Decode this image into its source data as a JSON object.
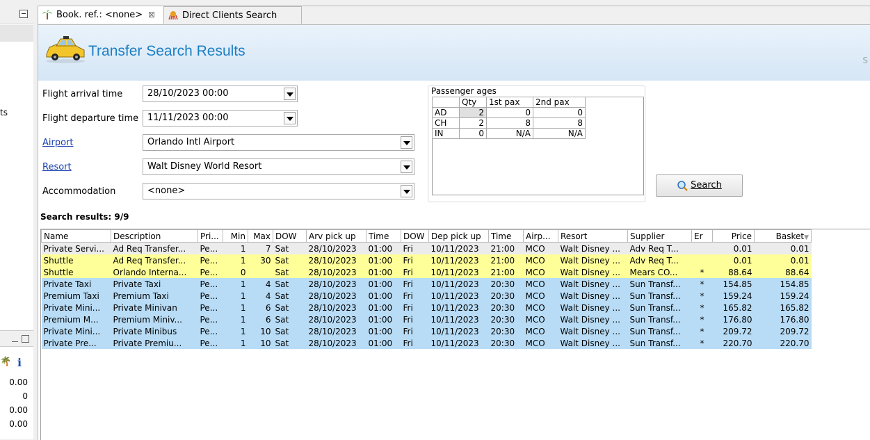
{
  "left_panel": {
    "partial_text": "ts",
    "values": [
      "0.00",
      "0",
      "0.00",
      "0.00"
    ]
  },
  "tabs": [
    {
      "label": "Book. ref.: <none>",
      "close": "⊠"
    },
    {
      "label": "Direct Clients Search"
    }
  ],
  "header": {
    "title": "Transfer Search Results",
    "edge_char": "S"
  },
  "form": {
    "flight_arrival": {
      "label": "Flight arrival time",
      "value": "28/10/2023 00:00"
    },
    "flight_departure": {
      "label": "Flight departure time",
      "value": "11/11/2023 00:00"
    },
    "airport": {
      "label": "Airport",
      "value": "Orlando Intl Airport"
    },
    "resort": {
      "label": "Resort",
      "value": "Walt Disney World Resort"
    },
    "accommodation": {
      "label": "Accommodation",
      "value": "<none>"
    }
  },
  "passengers": {
    "title": "Passenger ages",
    "headers": [
      "",
      "Qty",
      "1st pax",
      "2nd pax"
    ],
    "rows": [
      [
        "AD",
        "2",
        "0",
        "0"
      ],
      [
        "CH",
        "2",
        "8",
        "8"
      ],
      [
        "IN",
        "0",
        "N/A",
        "N/A"
      ]
    ]
  },
  "search_button": {
    "label": "Search"
  },
  "results": {
    "label": "Search results: 9/9",
    "headers": [
      "Name",
      "Description",
      "Pri...",
      "Min",
      "Max",
      "DOW",
      "Arv pick up",
      "Time",
      "DOW",
      "Dep pick up",
      "Time",
      "Airp...",
      "Resort",
      "Supplier",
      "Er",
      "Price",
      "Basket"
    ],
    "rows": [
      {
        "style": "sel",
        "cells": [
          "Private Servi...",
          "Ad Req Transfer...",
          "Pe...",
          "1",
          "7",
          "Sat",
          "28/10/2023",
          "01:00",
          "Fri",
          "10/11/2023",
          "21:00",
          "MCO",
          "Walt Disney ...",
          "Adv Req T...",
          "",
          "0.01",
          "0.01"
        ]
      },
      {
        "style": "yellow",
        "cells": [
          "Shuttle",
          "Ad Req Transfer...",
          "Pe...",
          "1",
          "30",
          "Sat",
          "28/10/2023",
          "01:00",
          "Fri",
          "10/11/2023",
          "21:00",
          "MCO",
          "Walt Disney ...",
          "Adv Req T...",
          "",
          "0.01",
          "0.01"
        ]
      },
      {
        "style": "yellow",
        "cells": [
          "Shuttle",
          "Orlando Interna...",
          "Pe...",
          "0",
          "",
          "Sat",
          "28/10/2023",
          "01:00",
          "Fri",
          "10/11/2023",
          "21:00",
          "MCO",
          "Walt Disney ...",
          "Mears CO...",
          "*",
          "88.64",
          "88.64"
        ]
      },
      {
        "style": "blue",
        "cells": [
          "Private Taxi",
          "Private Taxi",
          "Pe...",
          "1",
          "4",
          "Sat",
          "28/10/2023",
          "01:00",
          "Fri",
          "10/11/2023",
          "20:30",
          "MCO",
          "Walt Disney ...",
          "Sun Transf...",
          "*",
          "154.85",
          "154.85"
        ]
      },
      {
        "style": "blue",
        "cells": [
          "Premium Taxi",
          "Premium Taxi",
          "Pe...",
          "1",
          "4",
          "Sat",
          "28/10/2023",
          "01:00",
          "Fri",
          "10/11/2023",
          "20:30",
          "MCO",
          "Walt Disney ...",
          "Sun Transf...",
          "*",
          "159.24",
          "159.24"
        ]
      },
      {
        "style": "blue",
        "cells": [
          "Private Mini...",
          "Private Minivan",
          "Pe...",
          "1",
          "6",
          "Sat",
          "28/10/2023",
          "01:00",
          "Fri",
          "10/11/2023",
          "20:30",
          "MCO",
          "Walt Disney ...",
          "Sun Transf...",
          "*",
          "165.82",
          "165.82"
        ]
      },
      {
        "style": "blue",
        "cells": [
          "Premium M...",
          "Premium Miniv...",
          "Pe...",
          "1",
          "6",
          "Sat",
          "28/10/2023",
          "01:00",
          "Fri",
          "10/11/2023",
          "20:30",
          "MCO",
          "Walt Disney ...",
          "Sun Transf...",
          "*",
          "176.80",
          "176.80"
        ]
      },
      {
        "style": "blue",
        "cells": [
          "Private Mini...",
          "Private Minibus",
          "Pe...",
          "1",
          "10",
          "Sat",
          "28/10/2023",
          "01:00",
          "Fri",
          "10/11/2023",
          "20:30",
          "MCO",
          "Walt Disney ...",
          "Sun Transf...",
          "*",
          "209.72",
          "209.72"
        ]
      },
      {
        "style": "blue",
        "cells": [
          "Private Pre...",
          "Private Premiu...",
          "Pe...",
          "1",
          "10",
          "Sat",
          "28/10/2023",
          "01:00",
          "Fri",
          "10/11/2023",
          "20:30",
          "MCO",
          "Walt Disney ...",
          "Sun Transf...",
          "*",
          "220.70",
          "220.70"
        ]
      }
    ]
  },
  "colors": {
    "title_blue": "#1c7fc4",
    "row_yellow": "#ffff99",
    "row_blue": "#b8dcf6",
    "link": "#1a3fb0"
  },
  "icons": [
    "palm-tree-icon",
    "close-icon",
    "octopus-icon",
    "taxi-icon",
    "search-icon",
    "dropdown-arrow-icon",
    "info-icon"
  ]
}
